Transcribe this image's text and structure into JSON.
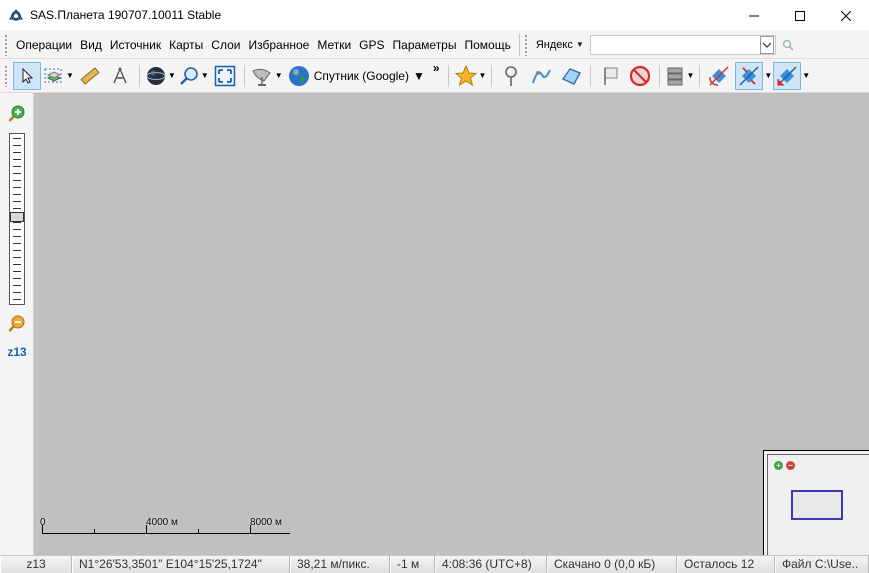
{
  "window": {
    "title": "SAS.Планета 190707.10011 Stable"
  },
  "menu": {
    "items": [
      "Операции",
      "Вид",
      "Источник",
      "Карты",
      "Слои",
      "Избранное",
      "Метки",
      "GPS",
      "Параметры",
      "Помощь"
    ]
  },
  "search": {
    "engine": "Яндекс",
    "value": ""
  },
  "toolbar": {
    "map_source": "Спутник (Google)",
    "overflow": "»"
  },
  "zoom": {
    "label": "z13"
  },
  "scale": {
    "labels": [
      "0",
      "4000 м",
      "8000 м"
    ]
  },
  "status": {
    "zoom": "z13",
    "coords": "N1°26'53,3501\" E104°15'25,1724\"",
    "resolution": "38,21 м/пикс.",
    "altitude": "-1 м",
    "time": "4:08:36 (UTC+8)",
    "downloaded": "Скачано 0 (0,0 кБ)",
    "remaining": "Осталось 12",
    "file": "Файл C:\\Use.."
  },
  "colors": {
    "map_bg": "#c0c0c0",
    "zoom_label": "#1a5fb4",
    "active_button": "#cfe4f7"
  }
}
